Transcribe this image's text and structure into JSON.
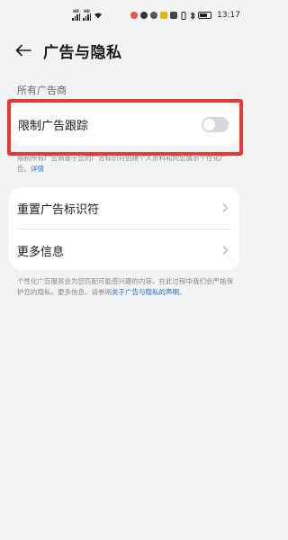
{
  "status_bar": {
    "sig1": "HD",
    "sig2": "HD",
    "time": "13:17"
  },
  "header": {
    "title": "广告与隐私"
  },
  "section": {
    "label": "所有广告商"
  },
  "limit_tracking": {
    "label": "限制广告跟踪",
    "enabled": false,
    "description": "限制所有广告商基于您的广告标识符创建个人资料和向您展示个性化广告。",
    "detail_link": "详情"
  },
  "list": {
    "items": [
      {
        "label": "重置广告标识符"
      },
      {
        "label": "更多信息"
      }
    ]
  },
  "footnote": {
    "text": "个性化广告服务会为您匹配可能感兴趣的内容，在此过程中我们会严格保护您的隐私。更多信息，请参阅",
    "link": "关于广告与隐私的声明",
    "end": "。"
  }
}
